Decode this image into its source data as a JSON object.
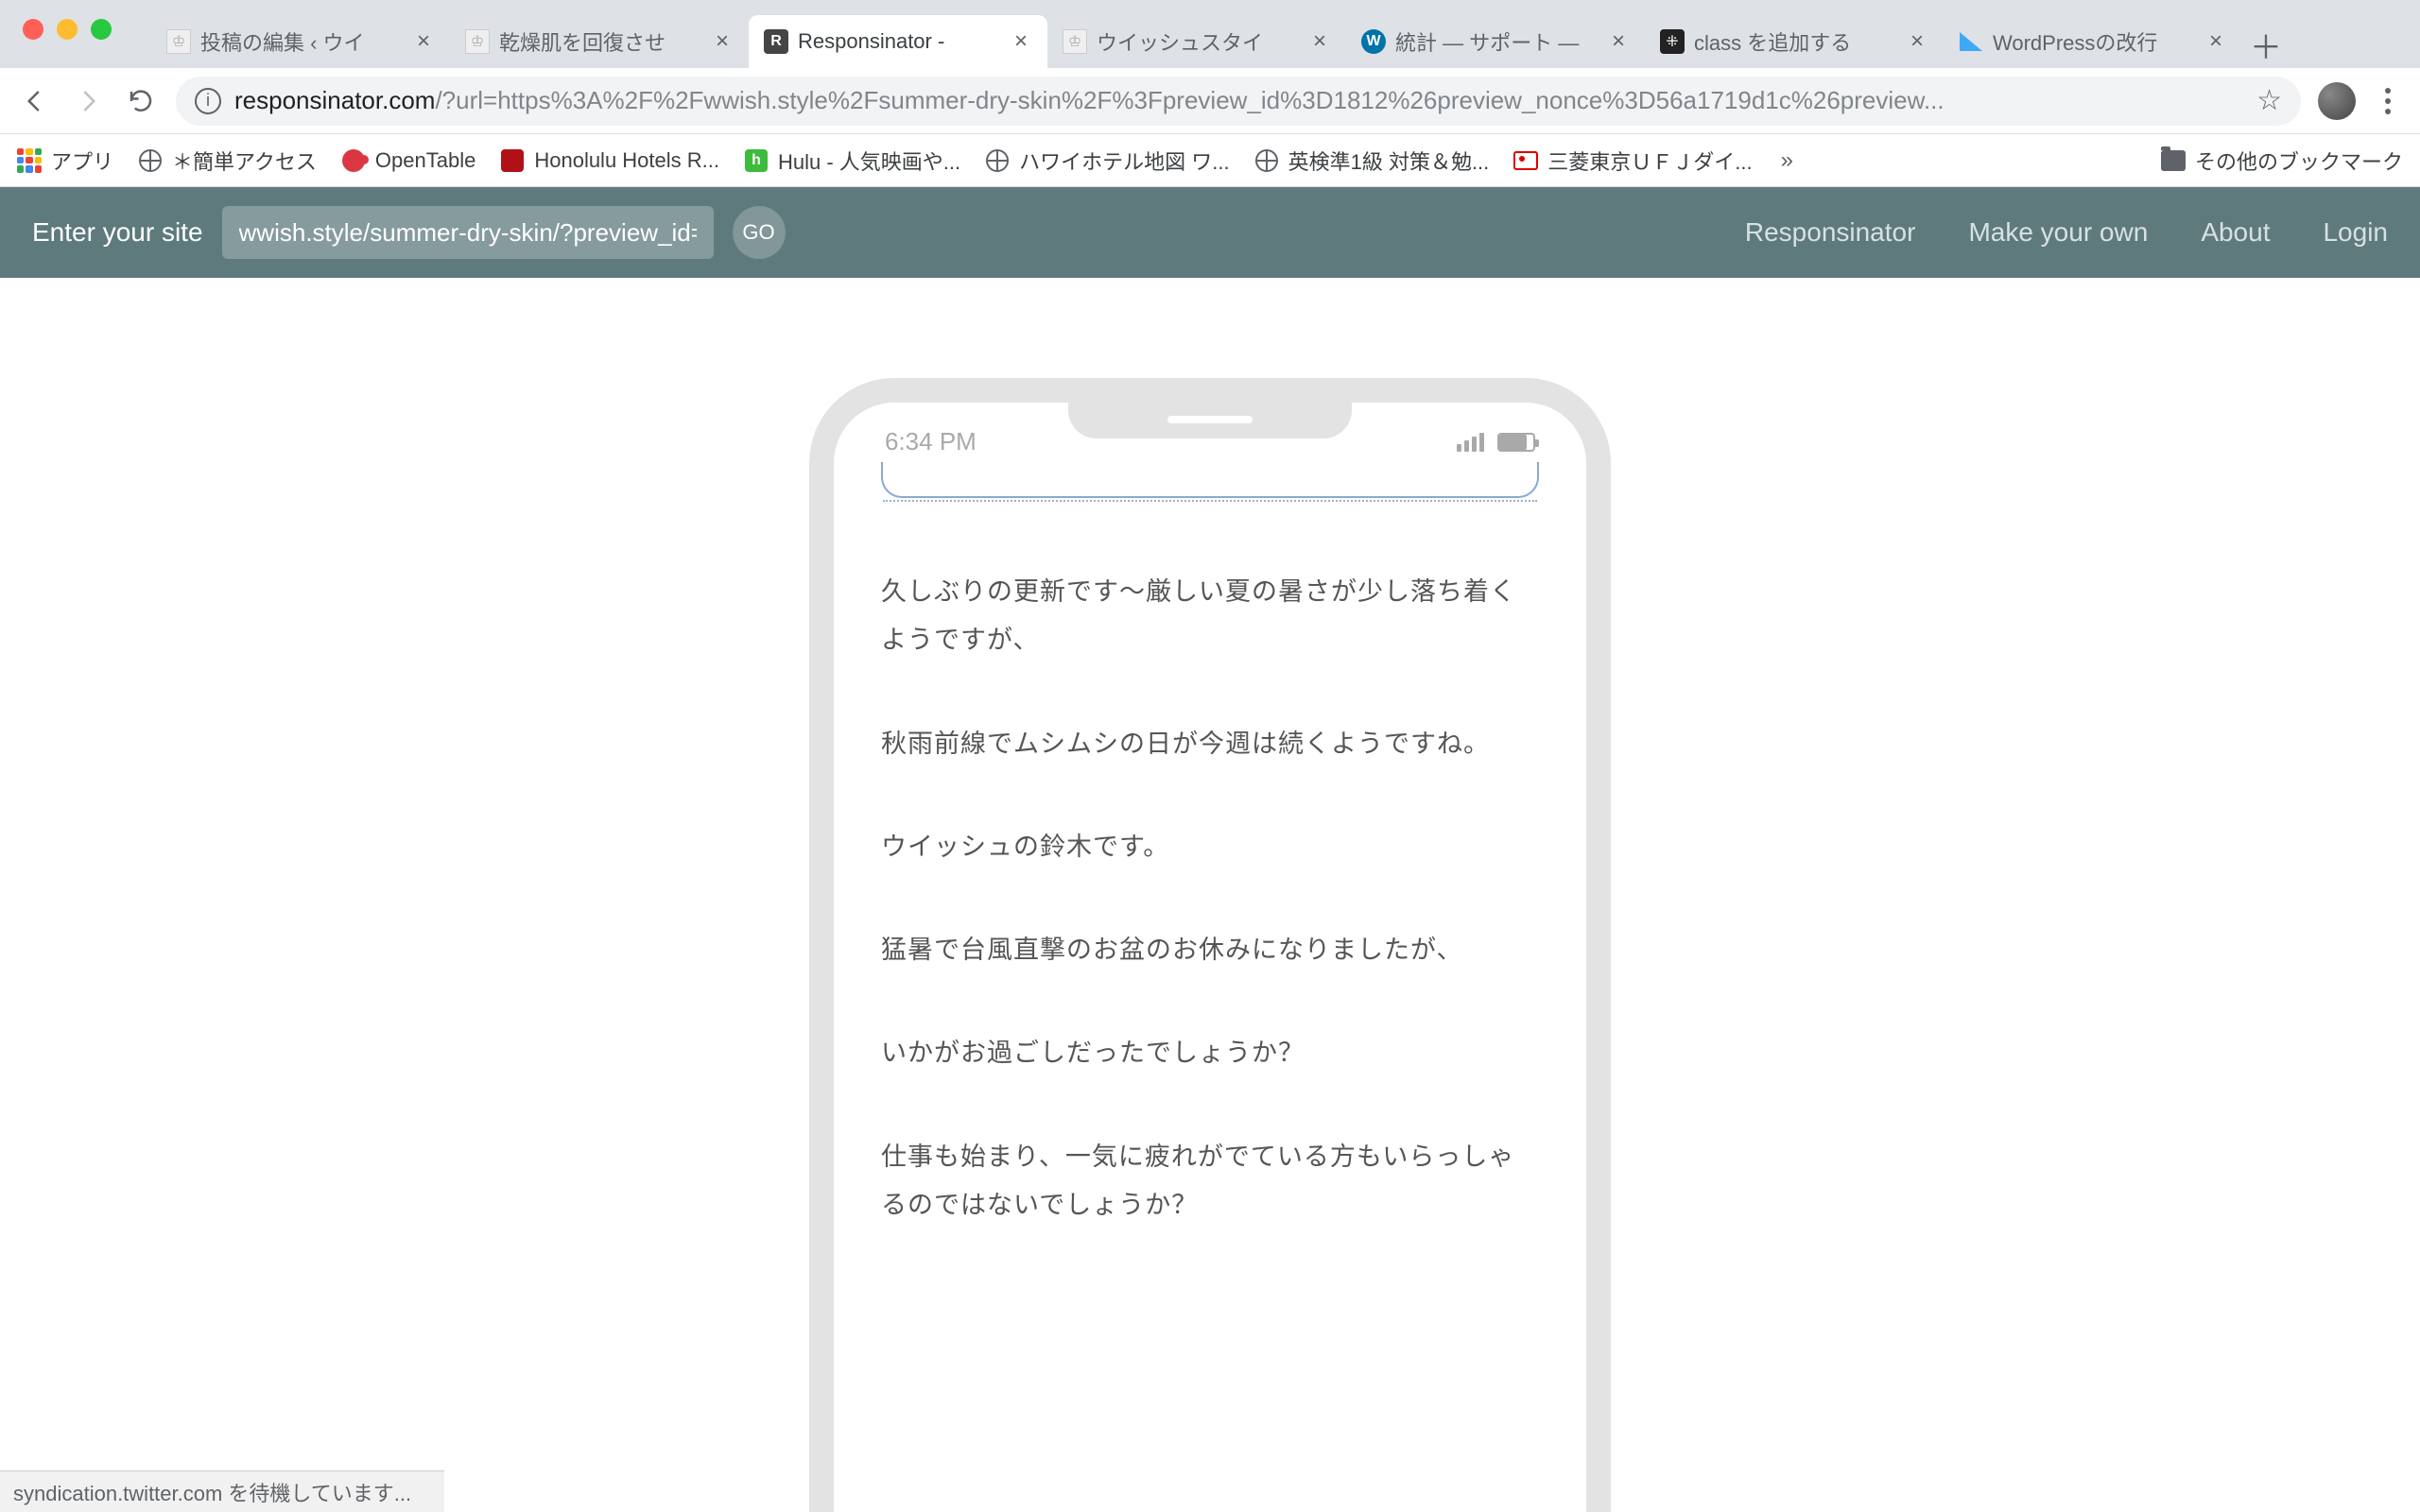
{
  "tabs": [
    {
      "title": "投稿の編集 ‹ ウイ",
      "icon": "crown"
    },
    {
      "title": "乾燥肌を回復させ",
      "icon": "crown"
    },
    {
      "title": "Responsinator -",
      "icon": "R",
      "active": true
    },
    {
      "title": "ウイッシュスタイ",
      "icon": "crown"
    },
    {
      "title": "統計 — サポート —",
      "icon": "wp"
    },
    {
      "title": "class を追加する",
      "icon": "dark"
    },
    {
      "title": "WordPressの改行",
      "icon": "tri"
    }
  ],
  "address": {
    "host": "responsinator.com",
    "path": "/?url=https%3A%2F%2Fwwish.style%2Fsummer-dry-skin%2F%3Fpreview_id%3D1812%26preview_nonce%3D56a1719d1c%26preview..."
  },
  "bookmarks": {
    "apps": "アプリ",
    "items": [
      {
        "label": "＊簡単アクセス",
        "icon": "globe"
      },
      {
        "label": "OpenTable",
        "icon": "ot"
      },
      {
        "label": "Honolulu Hotels R...",
        "icon": "ma"
      },
      {
        "label": "Hulu - 人気映画や...",
        "icon": "hu"
      },
      {
        "label": "ハワイホテル地図 ワ...",
        "icon": "globe"
      },
      {
        "label": "英検準1級 対策＆勉...",
        "icon": "globe"
      },
      {
        "label": "三菱東京ＵＦＪダイ...",
        "icon": "mu"
      }
    ],
    "overflow": "»",
    "other": "その他のブックマーク"
  },
  "resp": {
    "prompt": "Enter your site",
    "input_value": "wwish.style/summer-dry-skin/?preview_id=",
    "go": "GO",
    "links": [
      "Responsinator",
      "Make your own",
      "About",
      "Login"
    ]
  },
  "phone": {
    "time": "6:34 PM",
    "paragraphs": [
      "久しぶりの更新です〜厳しい夏の暑さが少し落ち着くようですが、",
      "秋雨前線でムシムシの日が今週は続くようですね。",
      "ウイッシュの鈴木です。",
      "猛暑で台風直撃のお盆のお休みになりましたが、",
      "いかがお過ごしだったでしょうか？",
      "仕事も始まり、一気に疲れがでている方もいらっしゃるのではないでしょうか？"
    ]
  },
  "status_bottom": "syndication.twitter.com を待機しています..."
}
